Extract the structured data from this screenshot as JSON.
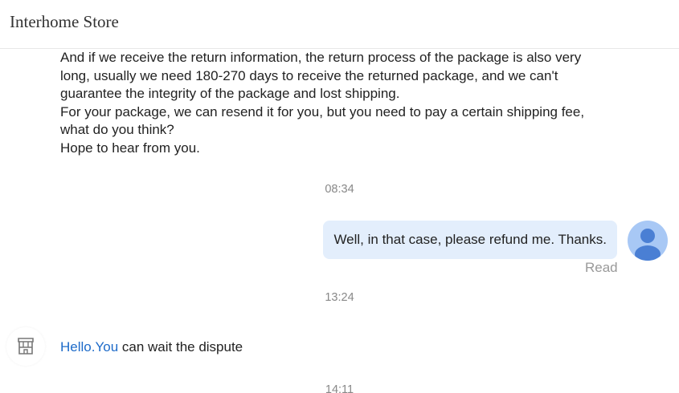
{
  "header": {
    "title": "Interhome Store"
  },
  "messages": {
    "seller_long": {
      "lines": [
        "And if we receive the return information, the return process of the package is also very",
        "long, usually we need 180-270 days to receive the returned package, and we can't",
        "guarantee the integrity of the package and lost shipping.",
        "For your package, we can resend it for you, but you need to pay a certain shipping fee,",
        "what do you think?",
        "Hope to hear from you."
      ]
    },
    "time_1": "08:34",
    "user_reply": {
      "text": "Well, in that case, please refund me. Thanks.",
      "status": "Read"
    },
    "time_2": "13:24",
    "seller_reply": {
      "link_text": "Hello.You",
      "text": " can wait the dispute"
    },
    "time_3": "14:11"
  },
  "colors": {
    "user_bubble": "#e3eefc",
    "link": "#1e6bc9",
    "avatar_bg": "#a8c8f5",
    "avatar_fg": "#4a7fd4"
  },
  "icons": {
    "user_avatar": "user-avatar-icon",
    "store": "store-icon"
  }
}
